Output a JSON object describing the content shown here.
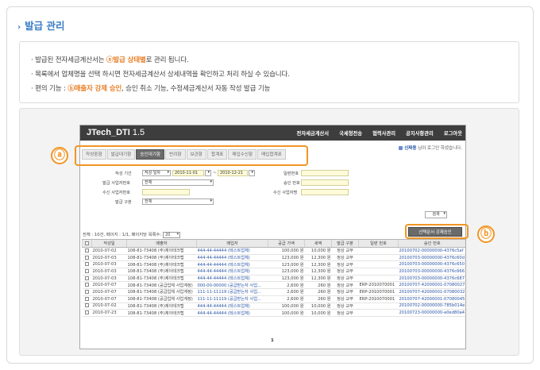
{
  "page": {
    "title": "발급 관리",
    "desc_lines": [
      {
        "pre": "· 발급된 전자세금계산서는 ",
        "hl": "ⓐ발급 상태별",
        "post": "로 관리 됩니다."
      },
      {
        "pre": "· 목록에서 업체명을 선택 하시면 전자세금계산서 상세내역을 확인하고 처리 하실 수 있습니다.",
        "hl": "",
        "post": ""
      },
      {
        "pre": "· 편의 기능 : ",
        "hl": "ⓑ매출자 강제 승인",
        "post": ", 승인 취소 기능, 수정세금계산서 자동 작성 발급 기능"
      }
    ],
    "accent_color": "#3a7cc5",
    "highlight_color": "#e8802a",
    "marker_color": "#f19624",
    "marker_a": "ⓐ",
    "marker_b": "ⓑ"
  },
  "app": {
    "brand": "JTech_DTI",
    "version": "1.5",
    "nav": [
      "전자세금계산서",
      "국세청전송",
      "협력사관리",
      "공지사항관리",
      "로그아웃"
    ],
    "user_name": "신짜용",
    "user_suffix": " 님이 로그인 하셨습니다.",
    "tabs": [
      "작성중함",
      "발급대기함",
      "승인대기함",
      "반려함",
      "보관함",
      "합계표",
      "매입수신함",
      "매입합계표"
    ],
    "active_tab_index": 2,
    "form": {
      "period_label": "작성 기간",
      "period_type": "작성 일자",
      "date_from": "2010-11-01",
      "date_to": "2010-12-21",
      "date_sep": "~",
      "issue_no_label": "일련번호",
      "issue_biz_label": "발급 사업자번호",
      "issue_biz_value": "전체",
      "approve_no_label": "승인 번호",
      "recv_biz_label": "수신 사업자번호",
      "recv_name_label": "수신 사업자명",
      "issue_type_label": "발급 구분",
      "issue_type_value": "전체"
    },
    "search_label": "검색",
    "meta": "전체 : 10건, 페이지 : 1/1, 페이지당 목록수:",
    "page_size": "20",
    "force_approve_label": "선택문서 강제승인",
    "columns": [
      "",
      "작성일",
      "매출자",
      "매입자",
      "공급 가액",
      "세액",
      "발급 구분",
      "일련 번호",
      "승인 번호"
    ],
    "rows": [
      [
        "2010-07-02",
        "108-81-73408 (주)제이테크랩",
        "444-44-44444 (테스트업체)",
        "100,000 원",
        "10,000 원",
        "정상 교부",
        "",
        "20100702-00000000-4376c5af"
      ],
      [
        "2010-07-03",
        "108-81-73408 (주)제이테크랩",
        "444-44-44444 (테스트업체)",
        "123,000 원",
        "12,300 원",
        "정상 교부",
        "",
        "20100703-00000000-4376c60d"
      ],
      [
        "2010-07-03",
        "108-81-73408 (주)제이테크랩",
        "444-44-44444 (테스트업체)",
        "123,000 원",
        "12,300 원",
        "정상 교부",
        "",
        "20100703-00000000-4376c650"
      ],
      [
        "2010-07-03",
        "108-81-73408 (주)제이테크랩",
        "444-44-44444 (테스트업체)",
        "123,000 원",
        "12,300 원",
        "정상 교부",
        "",
        "20100703-00000000-4376c666"
      ],
      [
        "2010-07-03",
        "108-81-73408 (주)제이테크랩",
        "444-44-44444 (테스트업체)",
        "123,000 원",
        "12,300 원",
        "정상 교부",
        "",
        "20100703-00000000-4376c687"
      ],
      [
        "2010-07-07",
        "108-81-73408 (공급업체 사업계정)",
        "000-00-00000 (공급받는자 사업...",
        "2,600 원",
        "260 원",
        "정상 교부",
        "ERP-2010070001",
        "20100707-42000001-07080027"
      ],
      [
        "2010-07-07",
        "108-81-73408 (공급업체 사업계정)",
        "111-11-11119 (공급받는자 사업...",
        "2,600 원",
        "260 원",
        "정상 교부",
        "ERP-2010070001",
        "20100707-42000001-07080032"
      ],
      [
        "2010-07-07",
        "108-81-73408 (공급업체 사업계정)",
        "111-11-11119 (공급받는자 사업...",
        "2,600 원",
        "260 원",
        "정상 교부",
        "ERP-2010070001",
        "20100707-42000001-07080045"
      ],
      [
        "2010-07-02",
        "108-81-73408 (주)제이테크랩",
        "444-44-44444 (테스트업체)",
        "100,000 원",
        "10,000 원",
        "정상 교부",
        "",
        "20100702-00000000-785b014e"
      ],
      [
        "2010-07-23",
        "108-81-73408 (주)제이테크랩",
        "444-44-44444 (테스트업체)",
        "100,000 원",
        "10,000 원",
        "정상 교부",
        "",
        "20100723-00000000-a0ed80a4"
      ]
    ],
    "current_page": "1"
  }
}
